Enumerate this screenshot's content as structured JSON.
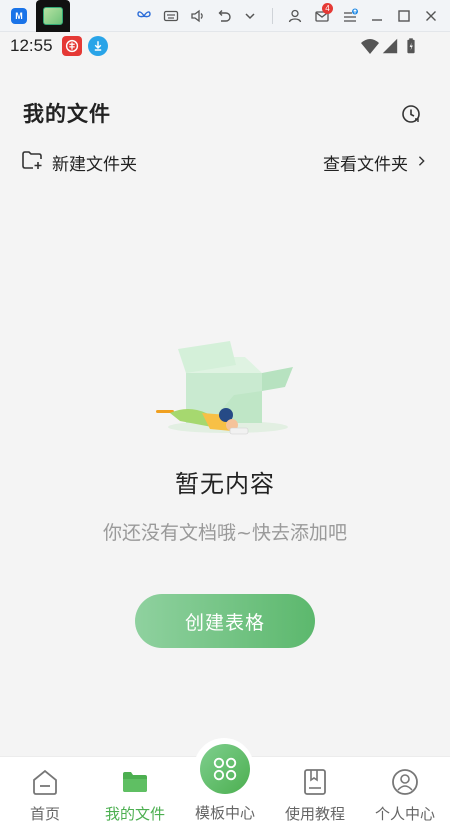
{
  "emulator_bar": {
    "notification_count": "4",
    "icons": [
      "app-logo-icon",
      "app-thumbnail-icon",
      "butterfly-icon",
      "keyboard-icon",
      "volume-icon",
      "rotate-icon",
      "chevron-down-icon",
      "user-icon",
      "mail-icon",
      "menu-update-icon",
      "minimize-icon",
      "maximize-icon",
      "close-icon"
    ]
  },
  "status_bar": {
    "time": "12:55",
    "icons": [
      "app-notify-icon",
      "download-icon",
      "wifi-icon",
      "signal-icon",
      "battery-icon"
    ]
  },
  "header": {
    "title": "我的文件",
    "history_icon": "history-clock-icon"
  },
  "folder_row": {
    "new_folder_label": "新建文件夹",
    "view_folder_label": "查看文件夹"
  },
  "empty_state": {
    "title": "暂无内容",
    "subtitle": "你还没有文档哦~快去添加吧",
    "button_label": "创建表格"
  },
  "tab_bar": {
    "tabs": [
      {
        "label": "首页",
        "icon": "home-icon",
        "active": false
      },
      {
        "label": "我的文件",
        "icon": "folder-icon",
        "active": true
      },
      {
        "label": "模板中心",
        "icon": "template-grid-icon",
        "active": false
      },
      {
        "label": "使用教程",
        "icon": "book-icon",
        "active": false
      },
      {
        "label": "个人中心",
        "icon": "profile-icon",
        "active": false
      }
    ]
  },
  "colors": {
    "accent": "#4caf50",
    "button_start": "#8fd19f",
    "button_end": "#5cb86d",
    "background": "#f4f4f4"
  }
}
